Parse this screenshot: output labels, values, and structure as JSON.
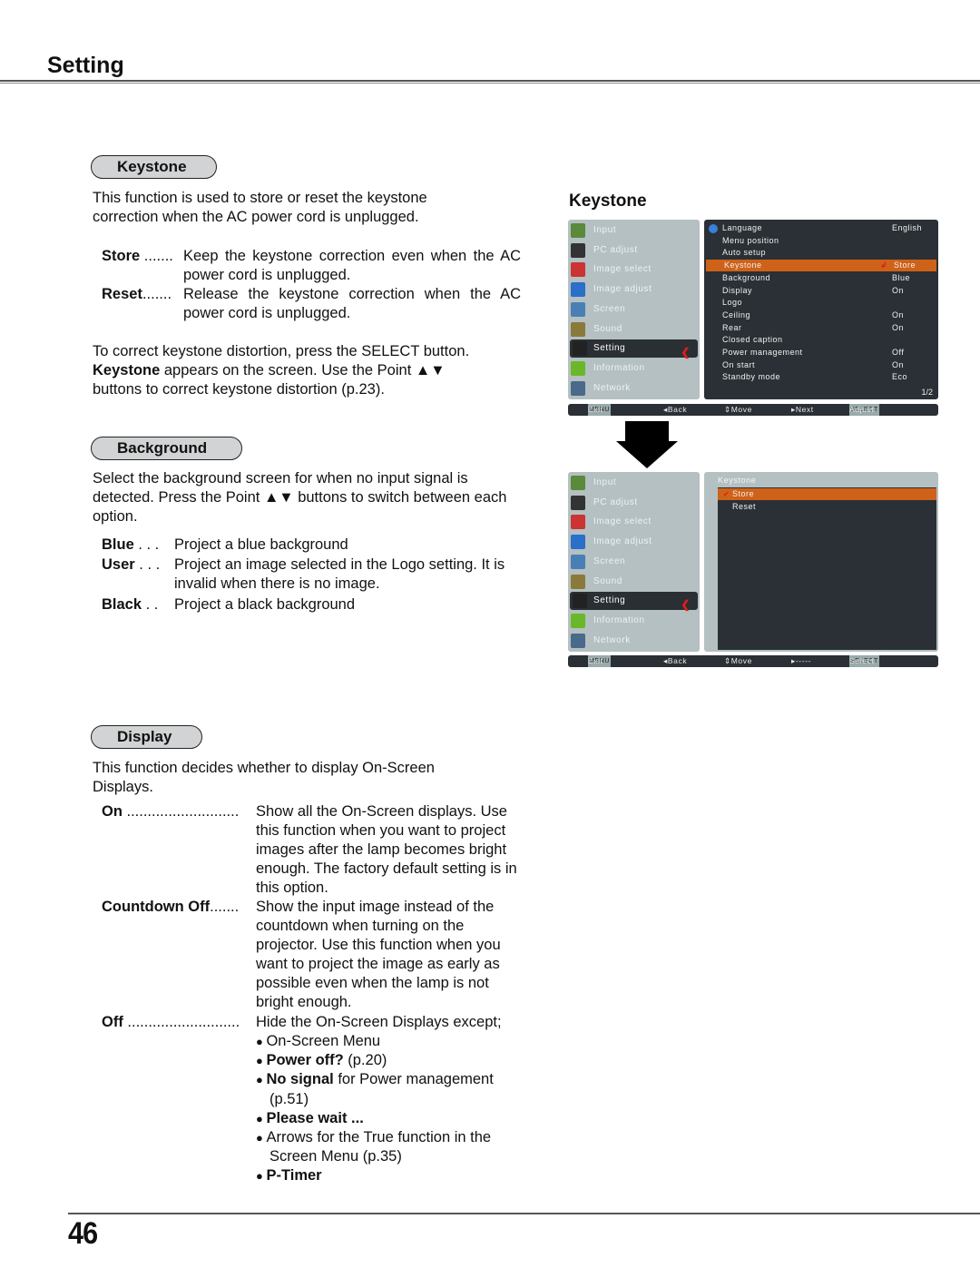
{
  "page": {
    "title": "Setting",
    "page_number": "46"
  },
  "keystone": {
    "pill": "Keystone",
    "intro": "This function is used to store or reset the keystone correction when the AC power cord is unplugged.",
    "options": [
      {
        "term": "Store",
        "dots": " .......",
        "desc": "Keep the keystone correction even when the AC power cord is unplugged."
      },
      {
        "term": "Reset",
        "dots": ".......",
        "desc": "Release the keystone correction when the AC power cord is unplugged."
      }
    ],
    "note_line1": "To correct keystone distortion, press the SELECT button.",
    "note_bold": "Keystone",
    "note_line2_rest": " appears on the screen. Use the Point ▲▼",
    "note_line3": "buttons to correct keystone distortion (p.23)."
  },
  "background": {
    "pill": "Background",
    "intro": "Select the background screen for when no input signal is detected. Press the Point ▲▼ buttons to switch between each option.",
    "options": [
      {
        "term": "Blue",
        "dots": " . . .",
        "desc": "Project a blue background"
      },
      {
        "term": "User",
        "dots": " . . .",
        "desc": "Project an image selected in the Logo setting. It is invalid when there is no image."
      },
      {
        "term": "Black",
        "dots": " . .",
        "desc": "Project a black background"
      }
    ]
  },
  "display": {
    "pill": "Display",
    "intro": "This function decides whether to display On-Screen Displays.",
    "options": [
      {
        "term": "On",
        "dots": " ...........................",
        "desc": "Show all the On-Screen displays. Use this function when you want to project images after the lamp becomes bright enough. The factory default setting is in this option."
      },
      {
        "term": "Countdown Off",
        "dots": ".......",
        "desc": "Show the input image instead of the countdown when turning on the projector. Use this function when you want to project the image as early as possible even when the lamp is not bright enough."
      },
      {
        "term": "Off",
        "dots": " ...........................",
        "desc": "Hide the On-Screen Displays except;"
      }
    ],
    "exceptions": [
      {
        "bold": "",
        "text": "On-Screen Menu"
      },
      {
        "bold": "Power off?",
        "text": " (p.20)"
      },
      {
        "bold": "No signal",
        "text": " for Power management (p.51)"
      },
      {
        "bold": "Please wait ...",
        "text": ""
      },
      {
        "bold": "",
        "text": "Arrows for the True function in the Screen Menu (p.35)"
      },
      {
        "bold": "P-Timer",
        "text": ""
      }
    ]
  },
  "figure": {
    "title": "Keystone",
    "main_menu": [
      "Input",
      "PC adjust",
      "Image select",
      "Image adjust",
      "Screen",
      "Sound",
      "Setting",
      "Information",
      "Network"
    ],
    "selected_main": "Setting",
    "osd1": {
      "items": [
        {
          "label": "Language",
          "value": "English"
        },
        {
          "label": "Menu position",
          "value": ""
        },
        {
          "label": "Auto setup",
          "value": ""
        },
        {
          "label": "Keystone",
          "value": "Store"
        },
        {
          "label": "Background",
          "value": "Blue"
        },
        {
          "label": "Display",
          "value": "On"
        },
        {
          "label": "Logo",
          "value": ""
        },
        {
          "label": "Ceiling",
          "value": "On"
        },
        {
          "label": "Rear",
          "value": "On"
        },
        {
          "label": "Closed caption",
          "value": ""
        },
        {
          "label": "Power management",
          "value": "Off"
        },
        {
          "label": "On start",
          "value": "On"
        },
        {
          "label": "Standby mode",
          "value": "Eco"
        }
      ],
      "page_indicator": "1/2",
      "footer": {
        "menu_key": "MENU",
        "exit": "Exit",
        "back": "◂Back",
        "move": "⇕Move",
        "next": "▸Next",
        "select_key": "SELECT",
        "action": "Adjust"
      }
    },
    "osd2": {
      "header": "Keystone",
      "items": [
        "Store",
        "Reset"
      ],
      "checked": "Store",
      "footer": {
        "menu_key": "MENU",
        "exit": "Exit",
        "back": "◂Back",
        "move": "⇕Move",
        "next": "▸-----",
        "select_key": "SELECT",
        "action": "Select"
      }
    },
    "colors": {
      "highlight": "#cf6219",
      "panel_dark": "#2a3035",
      "panel_light": "#b4c0c2",
      "arrow_red": "#e21b1b"
    }
  }
}
